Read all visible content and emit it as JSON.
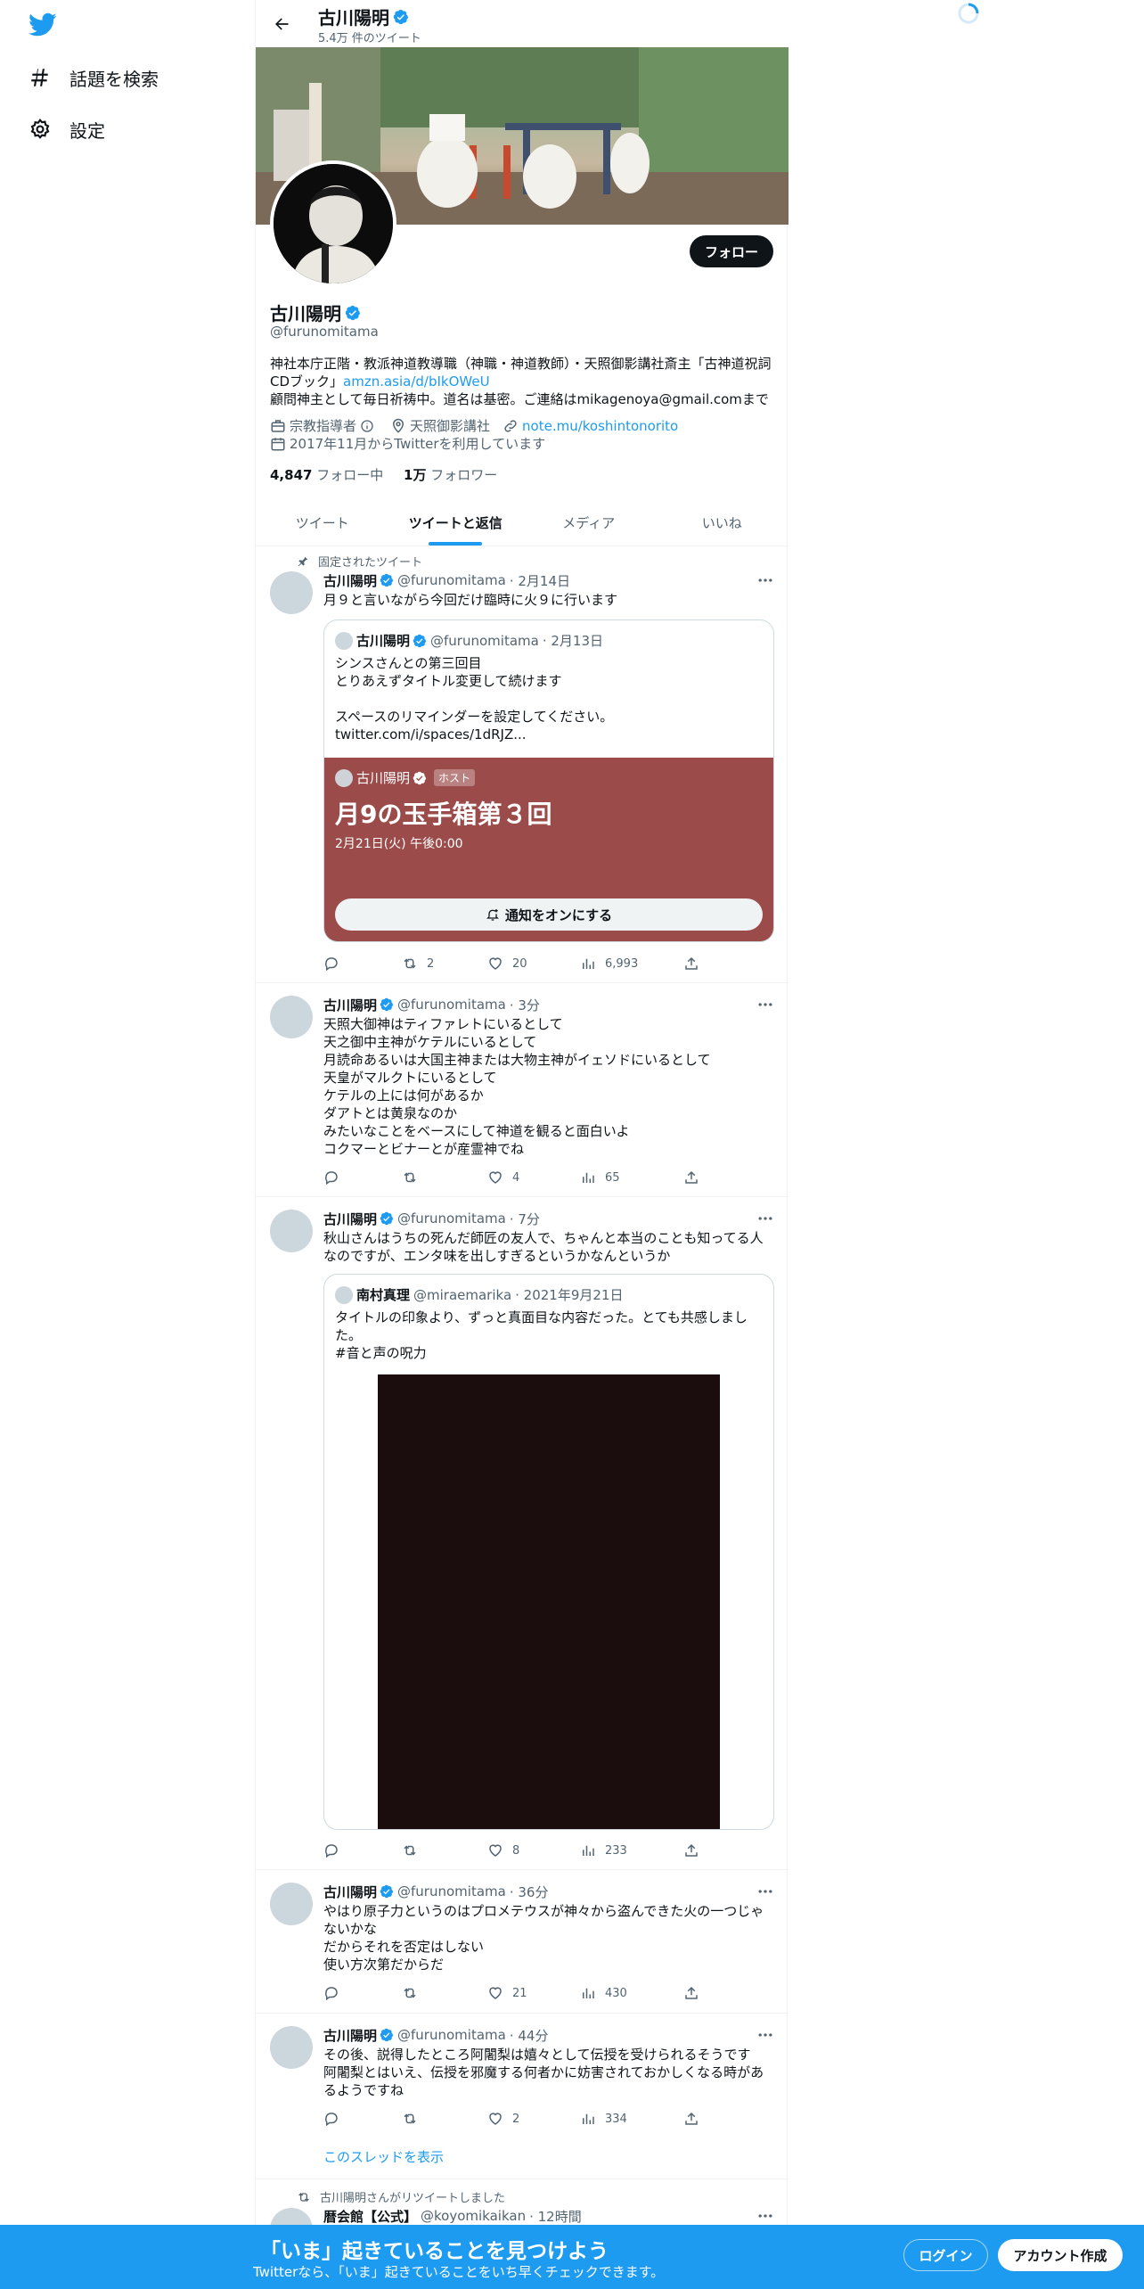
{
  "sidebar": {
    "items": [
      {
        "label": "話題を検索",
        "icon": "hashtag-icon"
      },
      {
        "label": "設定",
        "icon": "gear-icon"
      }
    ]
  },
  "header": {
    "name": "古川陽明",
    "tweet_count": "5.4万 件のツイート"
  },
  "profile": {
    "follow_label": "フォロー",
    "name": "古川陽明",
    "handle": "@furunomitama",
    "bio_line1": "神社本庁正階・教派神道教導職（神職・神道教師）・天照御影講社斎主「古神道祝詞CDブック」",
    "bio_link": "amzn.asia/d/bIkOWeU",
    "bio_line2": "顧問神主として毎日祈祷中。道名は基密。ご連絡はmikagenoya@gmail.comまで",
    "category": "宗教指導者",
    "location": "天照御影講社",
    "url": "note.mu/koshintonorito",
    "joined": "2017年11月からTwitterを利用しています",
    "following_count": "4,847",
    "following_label": "フォロー中",
    "followers_count": "1万",
    "followers_label": "フォロワー"
  },
  "tabs": [
    {
      "label": "ツイート",
      "active": false
    },
    {
      "label": "ツイートと返信",
      "active": true
    },
    {
      "label": "メディア",
      "active": false
    },
    {
      "label": "いいね",
      "active": false
    }
  ],
  "tweets": [
    {
      "pinned_label": "固定されたツイート",
      "name": "古川陽明",
      "handle": "@furunomitama",
      "time": "· 2月14日",
      "text": "月９と言いながら今回だけ臨時に火９に行います",
      "quote": {
        "name": "古川陽明",
        "handle": "@furunomitama",
        "time": "· 2月13日",
        "text": "シンスさんとの第三回目\nとりあえずタイトル変更して続けます\n\nスペースのリマインダーを設定してください。\ntwitter.com/i/spaces/1dRJZ...",
        "space": {
          "host_name": "古川陽明",
          "host_badge": "ホスト",
          "title": "月9の玉手箱第３回",
          "date": "2月21日(火) 午後0:00",
          "button": "通知をオンにする"
        }
      },
      "replies": "",
      "retweets": "2",
      "likes": "20",
      "views": "6,993"
    },
    {
      "name": "古川陽明",
      "handle": "@furunomitama",
      "time": "· 3分",
      "text": "天照大御神はティファレトにいるとして\n天之御中主神がケテルにいるとして\n月読命あるいは大国主神または大物主神がイェソドにいるとして\n天皇がマルクトにいるとして\nケテルの上には何があるか\nダアトとは黄泉なのか\nみたいなことをベースにして神道を観ると面白いよ\nコクマーとビナーとが産霊神でね",
      "replies": "",
      "retweets": "",
      "likes": "4",
      "views": "65"
    },
    {
      "name": "古川陽明",
      "handle": "@furunomitama",
      "time": "· 7分",
      "text": "秋山さんはうちの死んだ師匠の友人で、ちゃんと本当のことも知ってる人なのですが、エンタ味を出しすぎるというかなんというか",
      "quote": {
        "name": "南村真理",
        "handle": "@miraemarika",
        "time": "· 2021年9月21日",
        "text": "タイトルの印象より、ずっと真面目な内容だった。とても共感しました。\n#音と声の呪力"
      },
      "replies": "",
      "retweets": "",
      "likes": "8",
      "views": "233"
    },
    {
      "name": "古川陽明",
      "handle": "@furunomitama",
      "time": "· 36分",
      "text": "やはり原子力というのはプロメテウスが神々から盗んできた火の一つじゃないかな\nだからそれを否定はしない\n使い方次第だからだ",
      "replies": "",
      "retweets": "",
      "likes": "21",
      "views": "430"
    },
    {
      "name": "古川陽明",
      "handle": "@furunomitama",
      "time": "· 44分",
      "text": "その後、説得したところ阿闍梨は嬉々として伝授を受けられるそうです\n阿闍梨とはいえ、伝授を邪魔する何者かに妨害されておかしくなる時があるようですね",
      "replies": "",
      "retweets": "",
      "likes": "2",
      "views": "334",
      "show_thread": "このスレッドを表示"
    },
    {
      "retweet_label": "古川陽明さんがリツイートしました",
      "name": "暦会館【公式】",
      "handle": "@koyomikaikan",
      "time": "· 12時間"
    }
  ],
  "bottom_bar": {
    "title": "「いま」起きていることを見つけよう",
    "subtitle": "Twitterなら、「いま」起きていることをいち早くチェックできます。",
    "login": "ログイン",
    "signup": "アカウント作成"
  },
  "colors": {
    "accent": "#1d9bf0",
    "space_card": "#9b4c4a",
    "text": "#0f1419",
    "secondary_text": "#536471"
  }
}
